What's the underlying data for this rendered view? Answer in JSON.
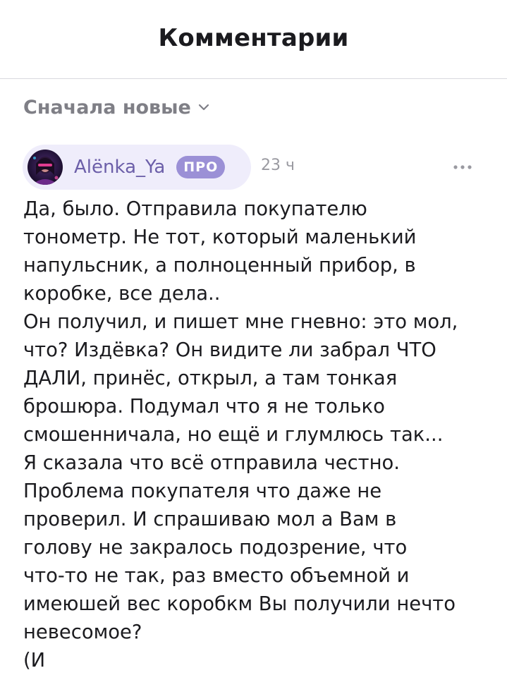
{
  "header": {
    "title": "Комментарии"
  },
  "sort": {
    "label": "Сначала новые",
    "icon": "chevron-down-icon"
  },
  "comment": {
    "author": "Alёnka_Ya",
    "badge": "ПРО",
    "time": "23 ч",
    "more_icon": "more-horizontal-icon",
    "text": "Да, было. Отправила покупателю\nтонометр. Не тот, который маленький\nнапульсник, а полноценный прибор, в\nкоробке, все дела..\nОн получил, и пишет мне гневно: это мол,\nчто? Издёвка? Он видите ли забрал ЧТО\nДАЛИ, принёс, открыл, а там тонкая\nброшюра. Подумал что я не только\nсмошенничала, но ещё и глумлюсь так...\nЯ сказала что всё отправила честно.\nПроблема покупателя что даже не\nпроверил. И спрашиваю мол а Вам в\nголову не закралось подозрение, что\nчто-то не так, раз вместо объемной и\nимеюшей вес коробкм Вы получили нечто\nневесомое?\n(И"
  },
  "colors": {
    "accent": "#6c5fa9",
    "badge": "#9b90d6",
    "pill": "#efedfb",
    "muted": "#7f7f86"
  }
}
